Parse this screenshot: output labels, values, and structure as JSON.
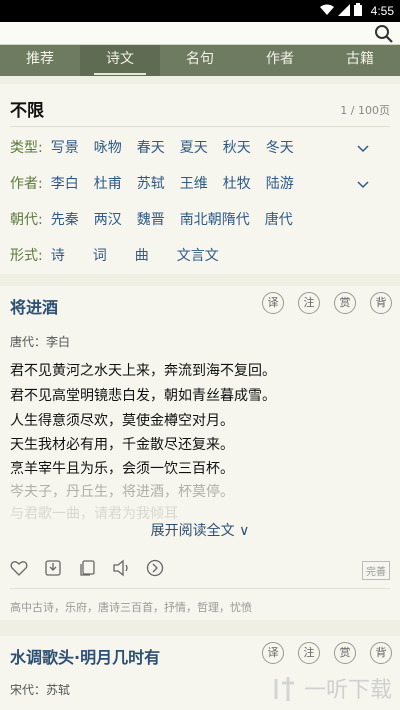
{
  "status": {
    "time": "4:55"
  },
  "search": {
    "placeholder": ""
  },
  "tabs": [
    "推荐",
    "诗文",
    "名句",
    "作者",
    "古籍"
  ],
  "filter": {
    "title": "不限",
    "count": "1 / 100页",
    "rows": [
      {
        "label": "类型:",
        "items": [
          "写景",
          "咏物",
          "春天",
          "夏天",
          "秋天",
          "冬天"
        ]
      },
      {
        "label": "作者:",
        "items": [
          "李白",
          "杜甫",
          "苏轼",
          "王维",
          "杜牧",
          "陆游"
        ]
      },
      {
        "label": "朝代:",
        "items": [
          "先秦",
          "两汉",
          "魏晋",
          "南北朝",
          "隋代",
          "唐代"
        ]
      },
      {
        "label": "形式:",
        "items": [
          "诗",
          "词",
          "曲",
          "文言文"
        ]
      }
    ]
  },
  "poems": [
    {
      "title": "将进酒",
      "author": "唐代：李白",
      "buttons": [
        "译",
        "注",
        "赏",
        "背"
      ],
      "lines": [
        "君不见黄河之水天上来，奔流到海不复回。",
        "君不见高堂明镜悲白发，朝如青丝暮成雪。",
        "人生得意须尽欢，莫使金樽空对月。",
        "天生我材必有用，千金散尽还复来。",
        "烹羊宰牛且为乐，会须一饮三百杯。",
        "岑夫子，丹丘生，将进酒，杯莫停。",
        "与君歌一曲，请君为我倾耳"
      ],
      "expand": "展开阅读全文 ∨",
      "badge": "完善",
      "tags": "高中古诗，乐府，唐诗三百首，抒情，哲理，忧愤"
    },
    {
      "title": "水调歌头·明月几时有",
      "author": "宋代：苏轼",
      "buttons": [
        "译",
        "注",
        "赏",
        "背"
      ]
    }
  ],
  "watermark": {
    "text": "一听下载"
  },
  "colors": {
    "tab_bar": "#6e7b61",
    "label_green": "#5d7a3c",
    "link_blue": "#2e5a87",
    "title_blue": "#2c4f74"
  }
}
